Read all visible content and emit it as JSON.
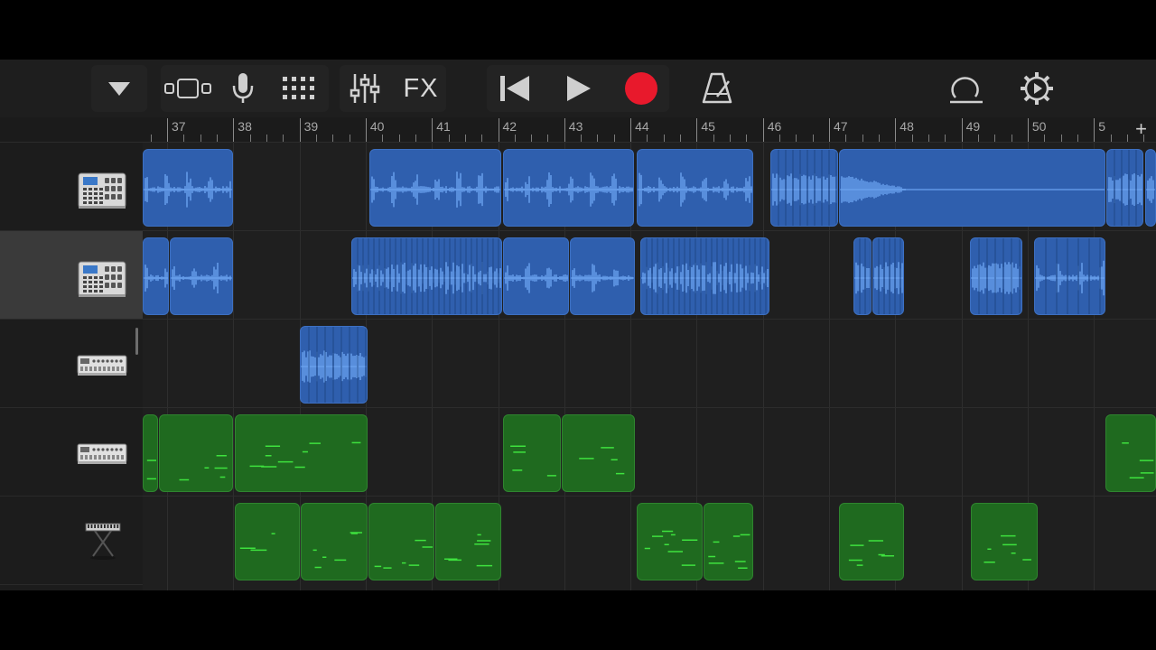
{
  "toolbar": {
    "buttons": [
      {
        "name": "browser-dropdown-button",
        "icon": "triangle-down-icon"
      },
      {
        "name": "tracks-view-button",
        "icon": "tracks-view-icon"
      },
      {
        "name": "microphone-button",
        "icon": "microphone-icon"
      },
      {
        "name": "grid-button",
        "icon": "grid-icon"
      },
      {
        "name": "mixer-button",
        "icon": "sliders-icon"
      },
      {
        "name": "fx-button",
        "label": "FX"
      },
      {
        "name": "go-to-start-button",
        "icon": "skip-back-icon"
      },
      {
        "name": "play-button",
        "icon": "play-icon"
      },
      {
        "name": "record-button",
        "icon": "record-icon"
      },
      {
        "name": "metronome-button",
        "icon": "metronome-icon"
      },
      {
        "name": "loop-browser-button",
        "icon": "loop-icon"
      },
      {
        "name": "settings-button",
        "icon": "gear-icon"
      }
    ],
    "fx_label": "FX"
  },
  "ruler": {
    "bars": [
      "37",
      "38",
      "39",
      "40",
      "41",
      "42",
      "43",
      "44",
      "45",
      "46",
      "47",
      "48",
      "49",
      "50",
      "5"
    ],
    "add_track_label": "+"
  },
  "colors": {
    "audio_region": "#2f5fae",
    "audio_wave": "#6fa8f5",
    "midi_region": "#1f6a1f",
    "midi_note": "#3ee23e",
    "record": "#e8192c"
  },
  "tracks": [
    {
      "name": "drum-machine-track-1",
      "icon": "drum-machine-icon",
      "type": "audio",
      "selected": false
    },
    {
      "name": "drum-machine-track-2",
      "icon": "drum-machine-icon",
      "type": "audio",
      "selected": true
    },
    {
      "name": "synth-module-track-1",
      "icon": "synth-module-icon",
      "type": "audio",
      "selected": false
    },
    {
      "name": "synth-module-track-2",
      "icon": "synth-module-icon",
      "type": "midi",
      "selected": false
    },
    {
      "name": "keyboard-track",
      "icon": "keyboard-stand-icon",
      "type": "midi",
      "selected": false
    }
  ]
}
